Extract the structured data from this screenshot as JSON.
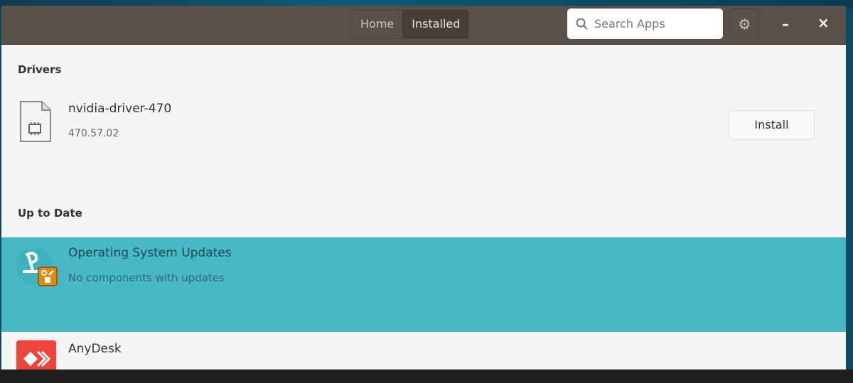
{
  "header": {
    "tabs": [
      "Home",
      "Installed"
    ],
    "active_tab": "Installed",
    "search_placeholder": "Search Apps",
    "minimize": "–",
    "close": "×"
  },
  "drivers": {
    "title": "Drivers",
    "items": [
      {
        "name": "nvidia-driver-470",
        "version": "470.57.02",
        "action": "Install"
      }
    ]
  },
  "up_to_date": {
    "title": "Up to Date",
    "items": [
      {
        "name": "Operating System Updates",
        "subtitle": "No components with updates"
      },
      {
        "name": "AnyDesk"
      }
    ]
  },
  "colors": {
    "header": "#5a504a",
    "selected": "#48b8c6",
    "anydesk": "#ef443b"
  }
}
